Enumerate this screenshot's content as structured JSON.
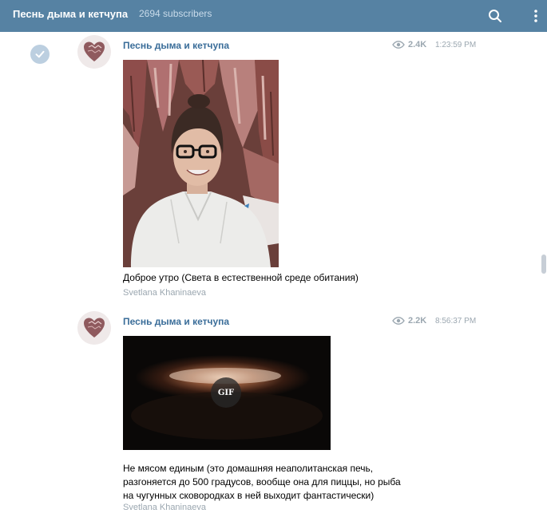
{
  "header": {
    "title": "Песнь дыма и кетчупа",
    "subscribers": "2694 subscribers",
    "search_icon": "search-icon",
    "more_icon": "more-vertical-icon",
    "bg_color": "#5682a3"
  },
  "messages": [
    {
      "author": "Песнь дыма и кетчупа",
      "views": "2.4K",
      "time": "1:23:59 PM",
      "media": "photo",
      "caption": "Доброе утро (Света в естественной среде обитания)",
      "signature": "Svetlana Khaninaeva",
      "selected": true
    },
    {
      "author": "Песнь дыма и кетчупа",
      "views": "2.2K",
      "time": "8:56:37 PM",
      "media": "gif",
      "media_label": "GIF",
      "caption": "Не мясом единым (это домашняя неаполитанская печь,\nразгоняется до 500 градусов, вообще она для пиццы, но рыба\nна чугунных сковородках в ней выходит фантастически)",
      "signature": "Svetlana Khaninaeva",
      "selected": false
    }
  ],
  "colors": {
    "author": "#3a6d99",
    "meta": "#9ba7b0",
    "check": "#bccfe0"
  }
}
